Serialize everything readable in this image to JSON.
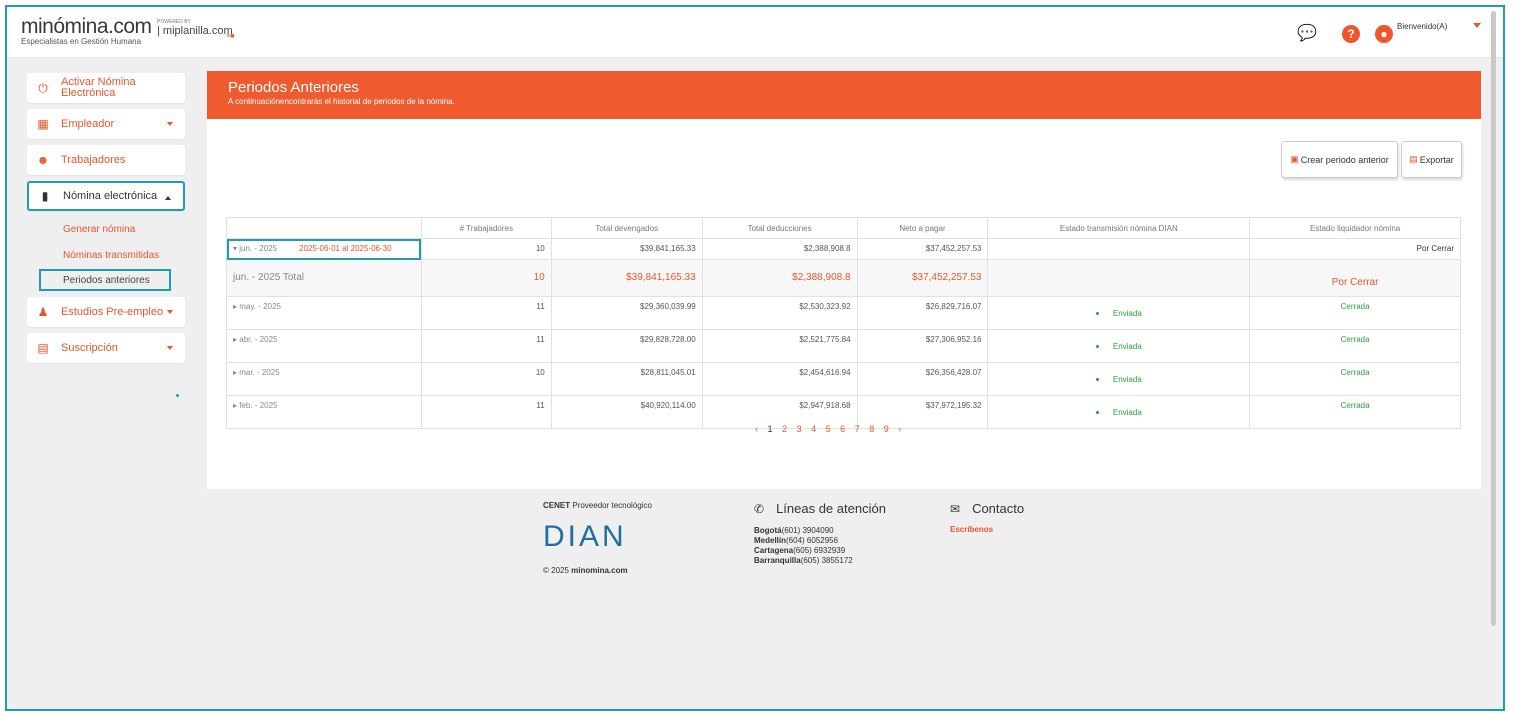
{
  "brand": {
    "name": "minómina.com",
    "tagline": "Especialistas en Gestión Humana",
    "powered": "POWERED BY",
    "partner": "miplanilla.com",
    "flag": "≡■"
  },
  "header": {
    "welcome": "Bienvenido(A)",
    "chat_icon": "chat-icon",
    "help_icon": "help-icon",
    "user_icon": "user-icon"
  },
  "sidebar": {
    "items": [
      {
        "label": "Activar Nómina Electrónica",
        "icon": "power-icon"
      },
      {
        "label": "Empleador",
        "icon": "building-icon"
      },
      {
        "label": "Trabajadores",
        "icon": "people-icon"
      },
      {
        "label": "Nómina electrónica",
        "icon": "document-icon"
      },
      {
        "label": "Estudios Pre-empleo",
        "icon": "person-plus-icon"
      },
      {
        "label": "Suscripción",
        "icon": "card-icon"
      }
    ],
    "subitems": [
      "Generar nómina",
      "Nóminas transmitidas",
      "Periodos anteriores"
    ]
  },
  "banner": {
    "title": "Periodos Anteriores",
    "subtitle": "A continuaciónencontrarás el historial de periodos de la nómina."
  },
  "buttons": {
    "create": "Crear periodo anterior",
    "export": "Exportar"
  },
  "table": {
    "headers": [
      "",
      "# Trabajadores",
      "Total devengados",
      "Total deducciones",
      "Neto a pagar",
      "Estado transmisión nómina DIAN",
      "Estado liquidador nómina"
    ],
    "rows": [
      {
        "period": "▾ jun. - 2025",
        "range": "2025-06-01 al 2025-06-30",
        "workers": "10",
        "devengados": "$39,841,165.33",
        "deducciones": "$2,388,908.8",
        "neto": "$37,452,257.53",
        "dian": "",
        "estado": "Por Cerrar"
      },
      {
        "period": "jun. - 2025 Total",
        "range": "",
        "workers": "10",
        "devengados": "$39,841,165.33",
        "deducciones": "$2,388,908.8",
        "neto": "$37,452,257.53",
        "dian": "",
        "estado": "Por Cerrar"
      },
      {
        "period": "▸ may. - 2025",
        "workers": "11",
        "devengados": "$29,360,039.99",
        "deducciones": "$2,530,323.92",
        "neto": "$26,829,716.07",
        "dian": "Enviada",
        "estado": "Cerrada"
      },
      {
        "period": "▸ abr. - 2025",
        "workers": "11",
        "devengados": "$29,828,728.00",
        "deducciones": "$2,521,775.84",
        "neto": "$27,306,952.16",
        "dian": "Enviada",
        "estado": "Cerrada"
      },
      {
        "period": "▸ mar. - 2025",
        "workers": "10",
        "devengados": "$28,811,045.01",
        "deducciones": "$2,454,616.94",
        "neto": "$26,356,428.07",
        "dian": "Enviada",
        "estado": "Cerrada"
      },
      {
        "period": "▸ feb. - 2025",
        "workers": "11",
        "devengados": "$40,920,114.00",
        "deducciones": "$2,947,918.68",
        "neto": "$37,972,195.32",
        "dian": "Enviada",
        "estado": "Cerrada"
      }
    ]
  },
  "pagination": {
    "prev": "‹",
    "pages": [
      "1",
      "2",
      "3",
      "4",
      "5",
      "6",
      "7",
      "8",
      "9"
    ],
    "next": "›"
  },
  "footer": {
    "cenet_bold": "CENET",
    "cenet_rest": " Proveedor tecnológico",
    "dian_logo": "DIAN",
    "copyright_pre": "© 2025 ",
    "copyright_bold": "minomina.com",
    "lines_title": "Líneas de atención",
    "lines": [
      {
        "city": "Bogotá",
        "phone": "(601) 3904090"
      },
      {
        "city": "Medellín",
        "phone": "(604) 6052956"
      },
      {
        "city": "Cartagena",
        "phone": "(605) 6932939"
      },
      {
        "city": "Barranquilla",
        "phone": "(605) 3855172"
      }
    ],
    "contact_title": "Contacto",
    "contact_link": "Escríbenos"
  },
  "colors": {
    "accent": "#ef5a2e",
    "highlight": "#1f9bb5",
    "success": "#2e9d3e"
  }
}
